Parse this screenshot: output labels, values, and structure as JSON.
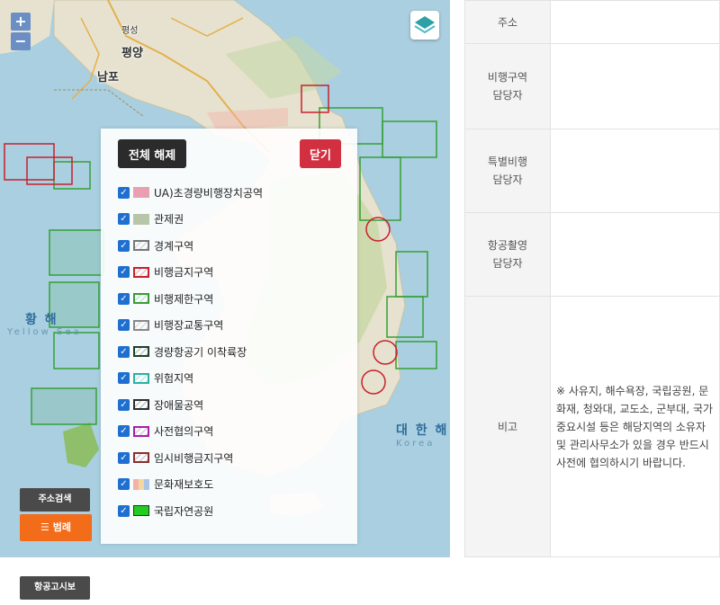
{
  "map": {
    "zoom_in": "+",
    "zoom_out": "−",
    "places": {
      "pyongseong": "평성",
      "pyongyang": "평양",
      "nampo": "남포"
    },
    "seas": {
      "yellow_sea_ko": "황 해",
      "yellow_sea_en": "Yellow Sea",
      "east_sea_ko": "대 한 해",
      "east_sea_en": "Korea"
    },
    "legend": {
      "deselect_all": "전체 해제",
      "close": "닫기",
      "items": [
        {
          "label": "UA)초경량비행장치공역",
          "checked": true,
          "swatch": "#e8a0b0"
        },
        {
          "label": "관제권",
          "checked": true,
          "swatch": "#b7c6a8"
        },
        {
          "label": "경계구역",
          "checked": true,
          "swatch": "#777777"
        },
        {
          "label": "비행금지구역",
          "checked": true,
          "swatch": "#c8202c"
        },
        {
          "label": "비행제한구역",
          "checked": true,
          "swatch": "#3a9a3a"
        },
        {
          "label": "비행장교통구역",
          "checked": true,
          "swatch": "#888888"
        },
        {
          "label": "경량항공기 이착륙장",
          "checked": true,
          "swatch": "#1f3f2a"
        },
        {
          "label": "위험지역",
          "checked": true,
          "swatch": "#29b1a6"
        },
        {
          "label": "장애물공역",
          "checked": true,
          "swatch": "#2d2d2d"
        },
        {
          "label": "사전협의구역",
          "checked": true,
          "swatch": "#a81fa8"
        },
        {
          "label": "임시비행금지구역",
          "checked": true,
          "swatch": "#8a2e2e"
        },
        {
          "label": "문화재보호도",
          "checked": true,
          "swatch": "#f2b2a6"
        },
        {
          "label": "국립자연공원",
          "checked": true,
          "swatch": "#22cc22"
        }
      ]
    },
    "address_search": "주소검색",
    "legend_button": "범례"
  },
  "info": {
    "rows": [
      {
        "label": "주소",
        "value": ""
      },
      {
        "label": "비행구역\n담당자",
        "value": ""
      },
      {
        "label": "특별비행\n담당자",
        "value": ""
      },
      {
        "label": "항공촬영\n담당자",
        "value": ""
      },
      {
        "label": "비고",
        "value": "※ 사유지, 해수욕장, 국립공원, 문화재, 청와대, 교도소, 군부대, 국가중요시설 등은 해당지역의 소유자 및 관리사무소가 있을 경우 반드시 사전에 협의하시기 바랍니다."
      }
    ]
  },
  "aviation_notice": "항공고시보",
  "colors": {
    "accent_close": "#d23040",
    "accent_legend": "#f26c1a",
    "dark_button": "#4a4a4a",
    "checkbox": "#1f6fd1"
  }
}
